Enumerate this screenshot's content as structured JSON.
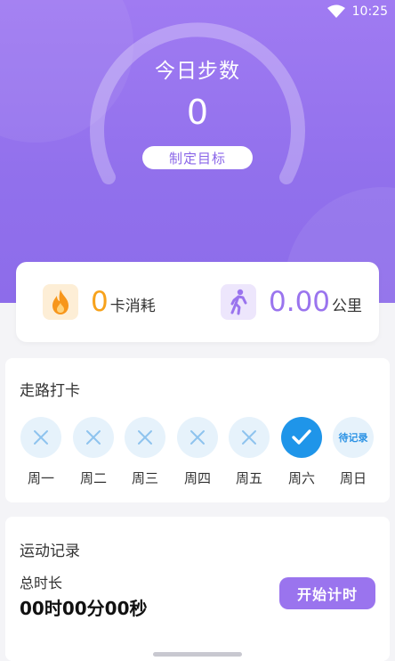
{
  "status_bar": {
    "time": "10:25",
    "icons": [
      "wifi-icon",
      "signal-icon"
    ]
  },
  "hero": {
    "title": "今日步数",
    "steps": "0",
    "goal_button": "制定目标",
    "goal_progress": 0
  },
  "stats": {
    "calories": {
      "value": "0",
      "unit": "卡消耗",
      "icon": "flame-icon",
      "color": "#f7a21b"
    },
    "distance": {
      "value": "0.00",
      "unit": "公里",
      "icon": "walking-person-icon",
      "color": "#9a74ee"
    }
  },
  "checkin": {
    "title": "走路打卡",
    "days": [
      {
        "label": "周一",
        "status": "missed"
      },
      {
        "label": "周二",
        "status": "missed"
      },
      {
        "label": "周三",
        "status": "missed"
      },
      {
        "label": "周四",
        "status": "missed"
      },
      {
        "label": "周五",
        "status": "missed"
      },
      {
        "label": "周六",
        "status": "done"
      },
      {
        "label": "周日",
        "status": "pending",
        "text": "待记录"
      }
    ]
  },
  "record": {
    "title": "运动记录",
    "duration_label": "总时长",
    "duration_value": "00时00分00秒",
    "start_button": "开始计时"
  },
  "colors": {
    "accent": "#9a74ee",
    "blue": "#1f95e9",
    "orange": "#f7a21b"
  }
}
